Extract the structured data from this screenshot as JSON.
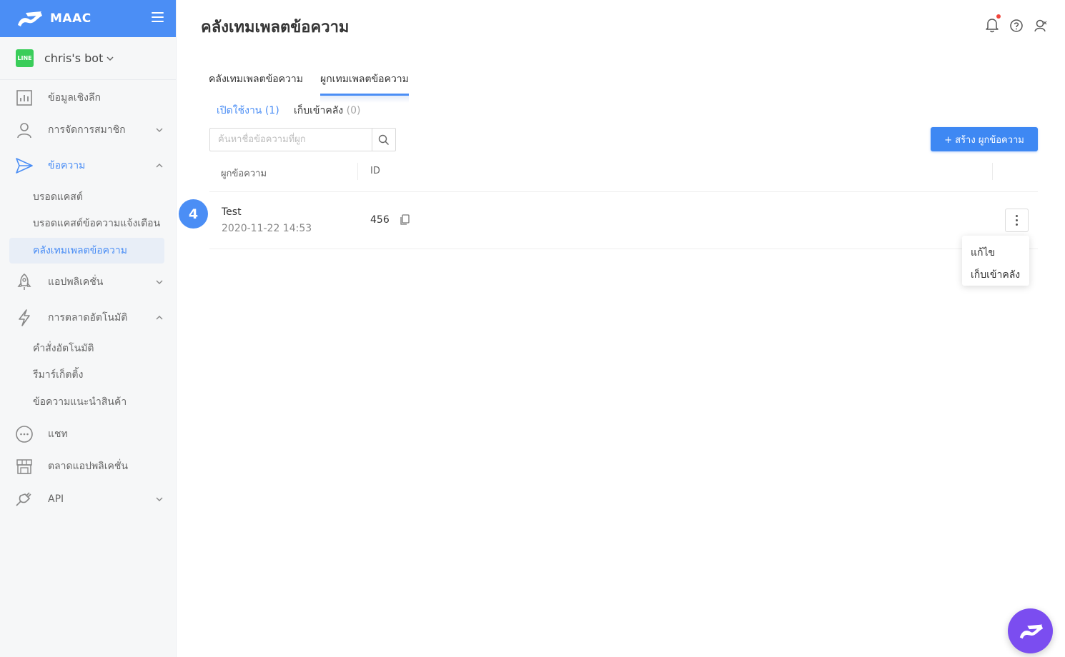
{
  "app": {
    "brand": "MAAC",
    "bot_name": "chris's bot",
    "channel_badge": "LINE"
  },
  "sidebar": {
    "items": [
      {
        "label": "ข้อมูลเชิงลึก",
        "icon": "bar-chart-icon"
      },
      {
        "label": "การจัดการสมาชิก",
        "icon": "user-icon"
      },
      {
        "label": "ข้อความ",
        "icon": "send-icon"
      },
      {
        "label": "แอปพลิเคชั่น",
        "icon": "rocket-icon"
      },
      {
        "label": "การตลาดอัตโนมัติ",
        "icon": "lightning-icon"
      },
      {
        "label": "แชท",
        "icon": "chat-icon"
      },
      {
        "label": "ตลาดแอปพลิเคชั่น",
        "icon": "store-icon"
      },
      {
        "label": "API",
        "icon": "plug-icon"
      }
    ],
    "message_sub": [
      "บรอดแคสต์",
      "บรอดแคสต์ข้อความแจ้งเตือน",
      "คลังเทมเพลตข้อความ"
    ],
    "automation_sub": [
      "คำสั่งอัตโนมัติ",
      "รีมาร์เก็ตติ้ง",
      "ข้อความแนะนำสินค้า"
    ]
  },
  "header": {
    "title": "คลังเทมเพลตข้อความ"
  },
  "tabs": [
    "คลังเทมเพลตข้อความ",
    "ผูกเทมเพลตข้อความ"
  ],
  "subtabs": {
    "active_label": "เปิดใช้งาน",
    "active_count": "(1)",
    "archived_label": "เก็บเข้าคลัง",
    "archived_count": "(0)"
  },
  "search": {
    "placeholder": "ค้นหาชื่อข้อความที่ผูก"
  },
  "create_button": "+ สร้าง ผูกข้อความ",
  "table": {
    "columns": [
      "ผูกข้อความ",
      "ID"
    ],
    "rows": [
      {
        "name": "Test",
        "date": "2020-11-22 14:53",
        "id": "456"
      }
    ]
  },
  "step_badge": "4",
  "row_menu": [
    "แก้ไข",
    "เก็บเข้าคลัง"
  ],
  "colors": {
    "accent": "#4b8ef5",
    "button": "#3e88f3",
    "fab": "#7b4df0",
    "line_green": "#3acd5a"
  }
}
